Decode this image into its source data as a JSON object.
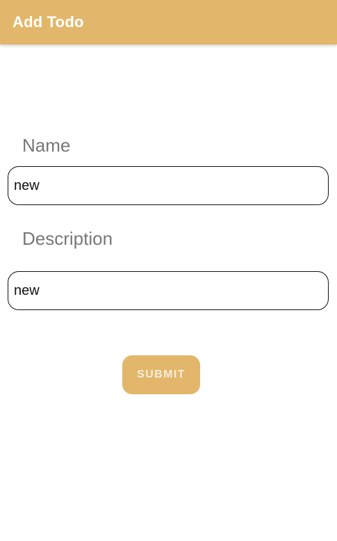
{
  "app_bar": {
    "title": "Add Todo",
    "color": "#E2B76B"
  },
  "form": {
    "name": {
      "label": "Name",
      "value": "new"
    },
    "description": {
      "label": "Description",
      "value": "new"
    },
    "submit_label": "SUBMIT",
    "submit_color": "#E2B76B"
  }
}
